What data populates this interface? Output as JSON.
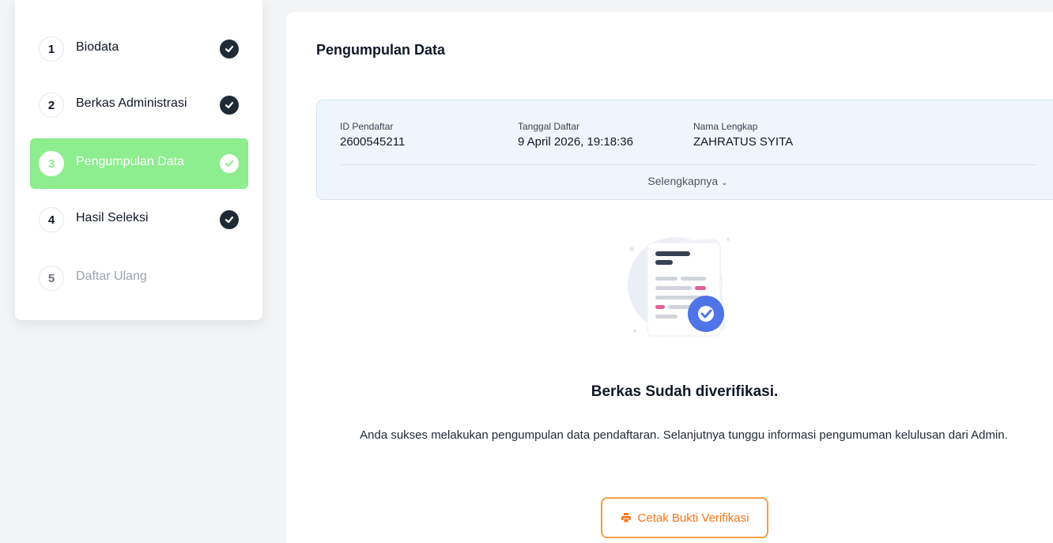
{
  "steps": [
    {
      "num": "1",
      "label": "Biodata",
      "state": "done"
    },
    {
      "num": "2",
      "label": "Berkas Administrasi",
      "state": "done"
    },
    {
      "num": "3",
      "label": "Pengumpulan Data",
      "state": "active"
    },
    {
      "num": "4",
      "label": "Hasil Seleksi",
      "state": "done"
    },
    {
      "num": "5",
      "label": "Daftar Ulang",
      "state": "disabled"
    }
  ],
  "main": {
    "title": "Pengumpulan Data",
    "info": {
      "id_label": "ID Pendaftar",
      "id_value": "2600545211",
      "date_label": "Tanggal Daftar",
      "date_value": "9 April 2026, 19:18:36",
      "name_label": "Nama Lengkap",
      "name_value": "ZAHRATUS SYITA",
      "more_label": "Selengkapnya"
    },
    "status_title": "Berkas Sudah diverifikasi.",
    "status_desc": "Anda sukses melakukan pengumpulan data pendaftaran. Selanjutnya tunggu informasi pengumuman kelulusan dari Admin.",
    "print_button": "Cetak Bukti Verifikasi"
  },
  "colors": {
    "active_step": "#8ded8f",
    "check_dark": "#1f2a37",
    "info_bg": "#eff6fb",
    "button_accent": "#f59e42"
  }
}
